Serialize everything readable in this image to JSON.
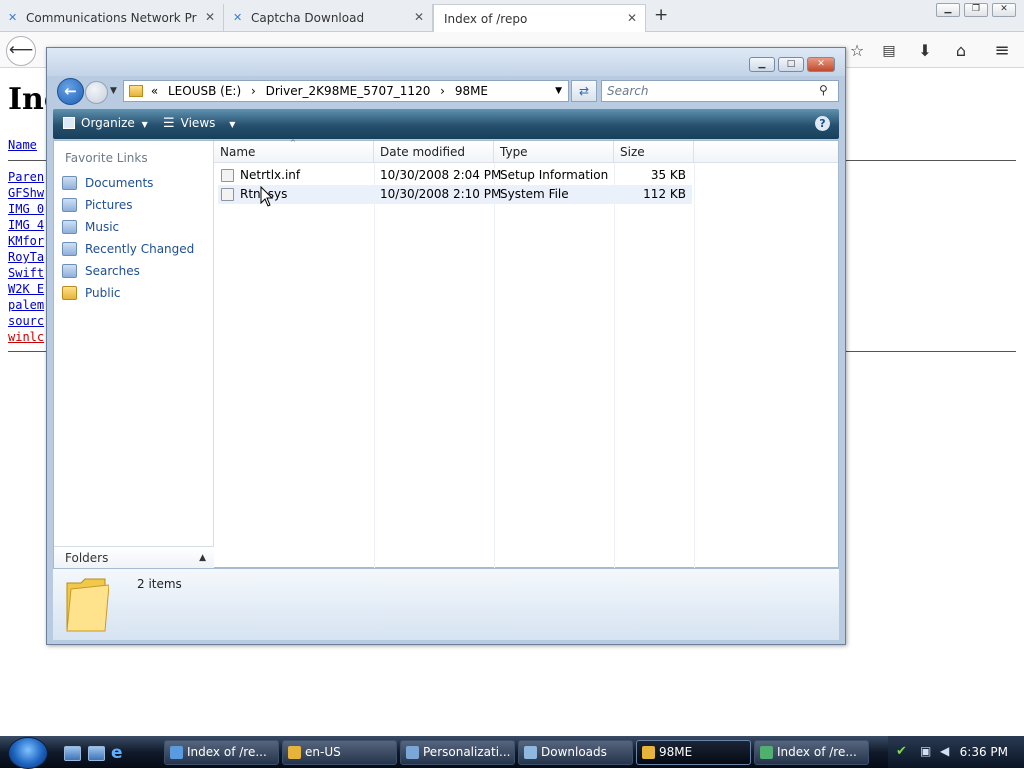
{
  "browser": {
    "tabs": [
      {
        "title": "Communications Network Pr"
      },
      {
        "title": "Captcha Download"
      },
      {
        "title": "Index of /repo"
      }
    ],
    "new_tab": "+"
  },
  "page": {
    "heading": "Inc",
    "column_name": "Name",
    "links": [
      "Paren",
      "GFShw",
      "IMG 0",
      "IMG 4",
      "KMfor",
      "RoyTa",
      "Swift",
      "W2K E",
      "palem",
      "sourc",
      "winlc"
    ]
  },
  "explorer": {
    "breadcrumb": {
      "prefix": "«",
      "parts": [
        "LEOUSB (E:)",
        "Driver_2K98ME_5707_1120",
        "98ME"
      ]
    },
    "search_placeholder": "Search",
    "toolbar": {
      "organize": "Organize",
      "views": "Views",
      "help": "?"
    },
    "favorite_links_title": "Favorite Links",
    "favorite_links": [
      "Documents",
      "Pictures",
      "Music",
      "Recently Changed",
      "Searches",
      "Public"
    ],
    "folders_label": "Folders",
    "columns": [
      "Name",
      "Date modified",
      "Type",
      "Size"
    ],
    "files": [
      {
        "name": "Netrtlx.inf",
        "date": "10/30/2008 2:04 PM",
        "type": "Setup Information",
        "size": "35 KB"
      },
      {
        "name": "Rtnl.sys",
        "date": "10/30/2008 2:10 PM",
        "type": "System File",
        "size": "112 KB"
      }
    ],
    "item_count": "2 items"
  },
  "taskbar": {
    "buttons": [
      "Index of /re...",
      "en-US",
      "Personalizati...",
      "Downloads",
      "98ME",
      "Index of /re..."
    ],
    "clock": "6:36 PM"
  }
}
